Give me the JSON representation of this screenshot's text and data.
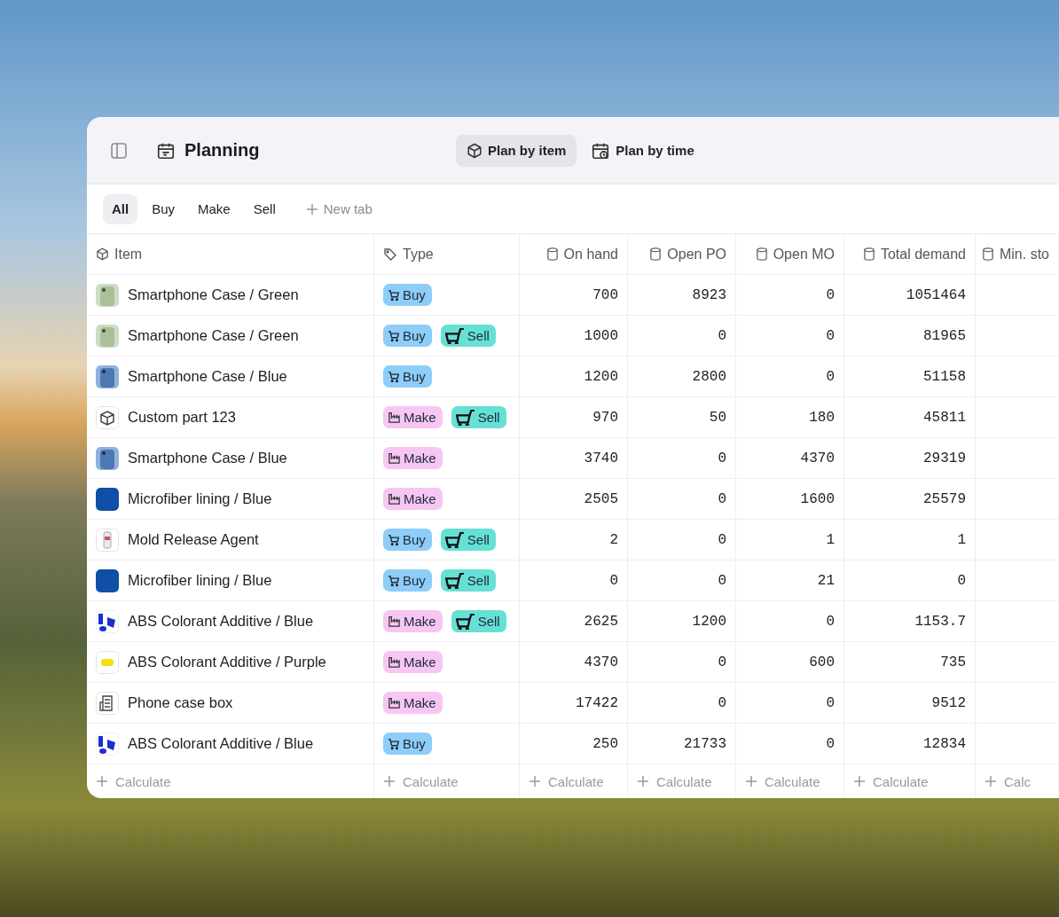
{
  "header": {
    "title": "Planning",
    "views": [
      {
        "label": "Plan by item",
        "kind": "item",
        "selected": true
      },
      {
        "label": "Plan by time",
        "kind": "time",
        "selected": false
      }
    ]
  },
  "tabs": [
    {
      "label": "All",
      "selected": true
    },
    {
      "label": "Buy",
      "selected": false
    },
    {
      "label": "Make",
      "selected": false
    },
    {
      "label": "Sell",
      "selected": false
    }
  ],
  "new_tab": "New tab",
  "table": {
    "columns": [
      {
        "label": "Item",
        "kind": "item"
      },
      {
        "label": "Type",
        "kind": "type"
      },
      {
        "label": "On hand",
        "kind": "number"
      },
      {
        "label": "Open PO",
        "kind": "number"
      },
      {
        "label": "Open MO",
        "kind": "number"
      },
      {
        "label": "Total demand",
        "kind": "number"
      },
      {
        "label": "Min. sto",
        "kind": "number"
      }
    ],
    "rows": [
      {
        "kind": "green_case",
        "name": "Smartphone Case / Green",
        "tags": [
          {
            "kind": "buy",
            "label": "Buy"
          }
        ],
        "values": [
          "700",
          "8923",
          "0",
          "1051464"
        ]
      },
      {
        "kind": "green_case",
        "name": "Smartphone Case / Green",
        "tags": [
          {
            "kind": "buy",
            "label": "Buy"
          },
          {
            "kind": "sell",
            "label": "Sell"
          }
        ],
        "values": [
          "1000",
          "0",
          "0",
          "81965"
        ]
      },
      {
        "kind": "blue_case",
        "name": "Smartphone Case / Blue",
        "tags": [
          {
            "kind": "buy",
            "label": "Buy"
          }
        ],
        "values": [
          "1200",
          "2800",
          "0",
          "51158"
        ]
      },
      {
        "kind": "cube",
        "name": "Custom part 123",
        "tags": [
          {
            "kind": "make",
            "label": "Make"
          },
          {
            "kind": "sell",
            "label": "Sell"
          }
        ],
        "values": [
          "970",
          "50",
          "180",
          "45811"
        ]
      },
      {
        "kind": "blue_case",
        "name": "Smartphone Case / Blue",
        "tags": [
          {
            "kind": "make",
            "label": "Make"
          }
        ],
        "values": [
          "3740",
          "0",
          "4370",
          "29319"
        ]
      },
      {
        "kind": "fabric",
        "name": "Microfiber lining / Blue",
        "tags": [
          {
            "kind": "make",
            "label": "Make"
          }
        ],
        "values": [
          "2505",
          "0",
          "1600",
          "25579"
        ]
      },
      {
        "kind": "bottle",
        "name": "Mold Release Agent",
        "tags": [
          {
            "kind": "buy",
            "label": "Buy"
          },
          {
            "kind": "sell",
            "label": "Sell"
          }
        ],
        "values": [
          "2",
          "0",
          "1",
          "1"
        ]
      },
      {
        "kind": "fabric",
        "name": "Microfiber lining / Blue",
        "tags": [
          {
            "kind": "buy",
            "label": "Buy"
          },
          {
            "kind": "sell",
            "label": "Sell"
          }
        ],
        "values": [
          "0",
          "0",
          "21",
          "0"
        ]
      },
      {
        "kind": "colorant_blue",
        "name": "ABS Colorant Additive / Blue",
        "tags": [
          {
            "kind": "make",
            "label": "Make"
          },
          {
            "kind": "sell",
            "label": "Sell"
          }
        ],
        "values": [
          "2625",
          "1200",
          "0",
          "1153.7"
        ]
      },
      {
        "kind": "colorant_yellow",
        "name": "ABS Colorant Additive / Purple",
        "tags": [
          {
            "kind": "make",
            "label": "Make"
          }
        ],
        "values": [
          "4370",
          "0",
          "600",
          "735"
        ]
      },
      {
        "kind": "box",
        "name": "Phone case box",
        "tags": [
          {
            "kind": "make",
            "label": "Make"
          }
        ],
        "values": [
          "17422",
          "0",
          "0",
          "9512"
        ]
      },
      {
        "kind": "colorant_blue",
        "name": "ABS Colorant Additive / Blue",
        "tags": [
          {
            "kind": "buy",
            "label": "Buy"
          }
        ],
        "values": [
          "250",
          "21733",
          "0",
          "12834"
        ]
      }
    ],
    "footer": [
      "Calculate",
      "Calculate",
      "Calculate",
      "Calculate",
      "Calculate",
      "Calculate",
      "Calc"
    ]
  }
}
